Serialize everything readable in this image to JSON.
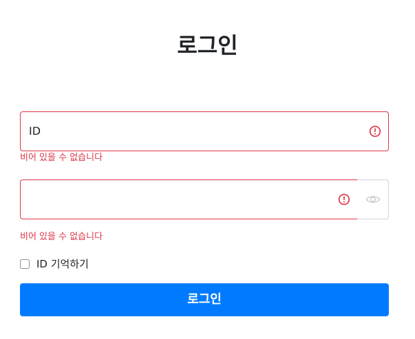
{
  "page": {
    "title": "로그인"
  },
  "form": {
    "id_field": {
      "value": "ID",
      "error": "비어 있을 수 없습니다"
    },
    "password_field": {
      "value": "",
      "error": "비어 있을 수 없습니다"
    },
    "remember_label": "ID 기억하기",
    "submit_label": "로그인"
  },
  "colors": {
    "error": "#dc3545",
    "primary": "#007bff"
  },
  "icons": {
    "error": "exclamation-circle-icon",
    "toggle_password": "eye-icon"
  }
}
